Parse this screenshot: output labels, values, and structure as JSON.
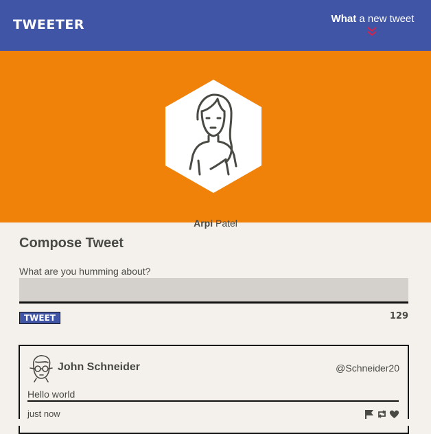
{
  "nav": {
    "brand": "TWEETER",
    "cta_bold": "What",
    "cta_rest": " a new tweet",
    "chevron_icon": "double-chevron-down",
    "chevron_color": "#d8224a"
  },
  "colors": {
    "nav_bg": "#4055a6",
    "banner_bg": "#f0820a",
    "page_bg": "#f4f1ec",
    "text": "#4a4a45",
    "input_bg": "#d4d1cd"
  },
  "profile": {
    "first_name": "Arpi",
    "last_name": " Patel",
    "avatar_icon": "woman-avatar"
  },
  "compose": {
    "title": "Compose Tweet",
    "label": "What are you humming about?",
    "value": "",
    "button_label": "TWEET",
    "char_count": "129"
  },
  "tweets": [
    {
      "avatar_icon": "man-glasses-avatar",
      "name": "John Schneider",
      "handle": "@Schneider20",
      "text": "Hello world",
      "time": "just now",
      "actions": [
        "flag-icon",
        "retweet-icon",
        "heart-icon"
      ]
    }
  ]
}
